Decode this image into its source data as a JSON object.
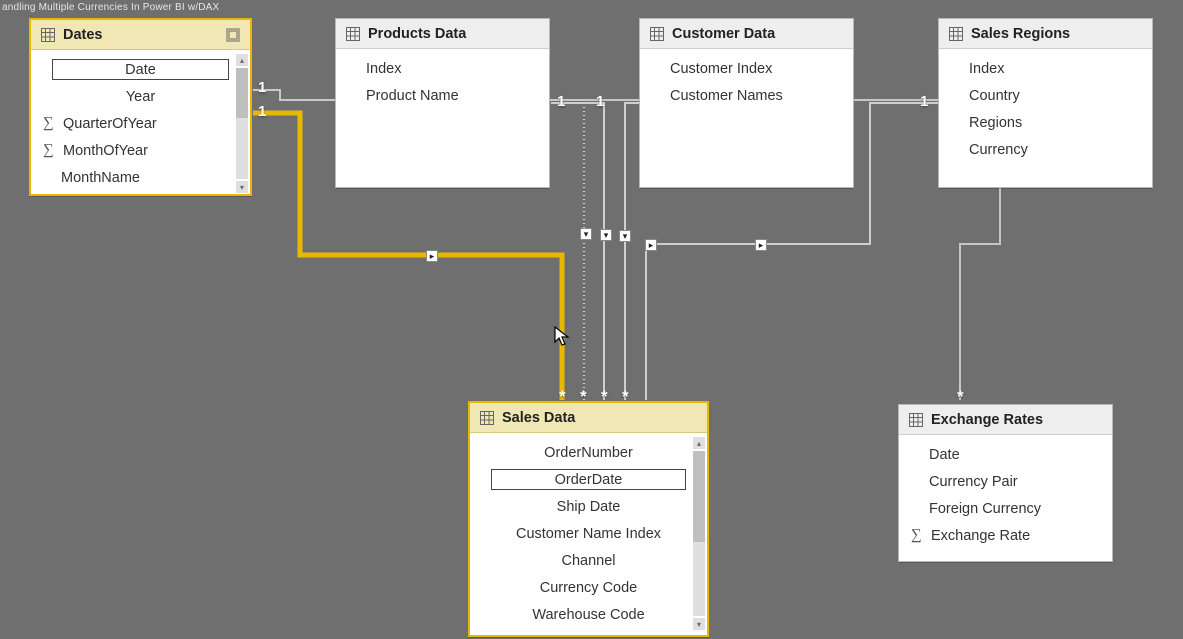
{
  "top_label": "andling Multiple Currencies In Power BI w/DAX",
  "tables": {
    "dates": {
      "title": "Dates",
      "fields": [
        "Date",
        "Year",
        "QuarterOfYear",
        "MonthOfYear",
        "MonthName"
      ],
      "measure_flags": [
        false,
        false,
        true,
        true,
        false
      ],
      "selected_field_index": 0
    },
    "products": {
      "title": "Products Data",
      "fields": [
        "Index",
        "Product Name"
      ]
    },
    "customer": {
      "title": "Customer Data",
      "fields": [
        "Customer Index",
        "Customer Names"
      ]
    },
    "regions": {
      "title": "Sales Regions",
      "fields": [
        "Index",
        "Country",
        "Regions",
        "Currency"
      ]
    },
    "sales": {
      "title": "Sales Data",
      "fields": [
        "OrderNumber",
        "OrderDate",
        "Ship Date",
        "Customer Name Index",
        "Channel",
        "Currency Code",
        "Warehouse Code"
      ],
      "selected_field_index": 1
    },
    "exchange": {
      "title": "Exchange Rates",
      "fields": [
        "Date",
        "Currency Pair",
        "Foreign Currency",
        "Exchange Rate"
      ],
      "measure_flags": [
        false,
        false,
        false,
        true
      ]
    }
  },
  "relationships": {
    "cardinality_one": "1",
    "cardinality_many": "*",
    "filter_direction": "▸"
  }
}
